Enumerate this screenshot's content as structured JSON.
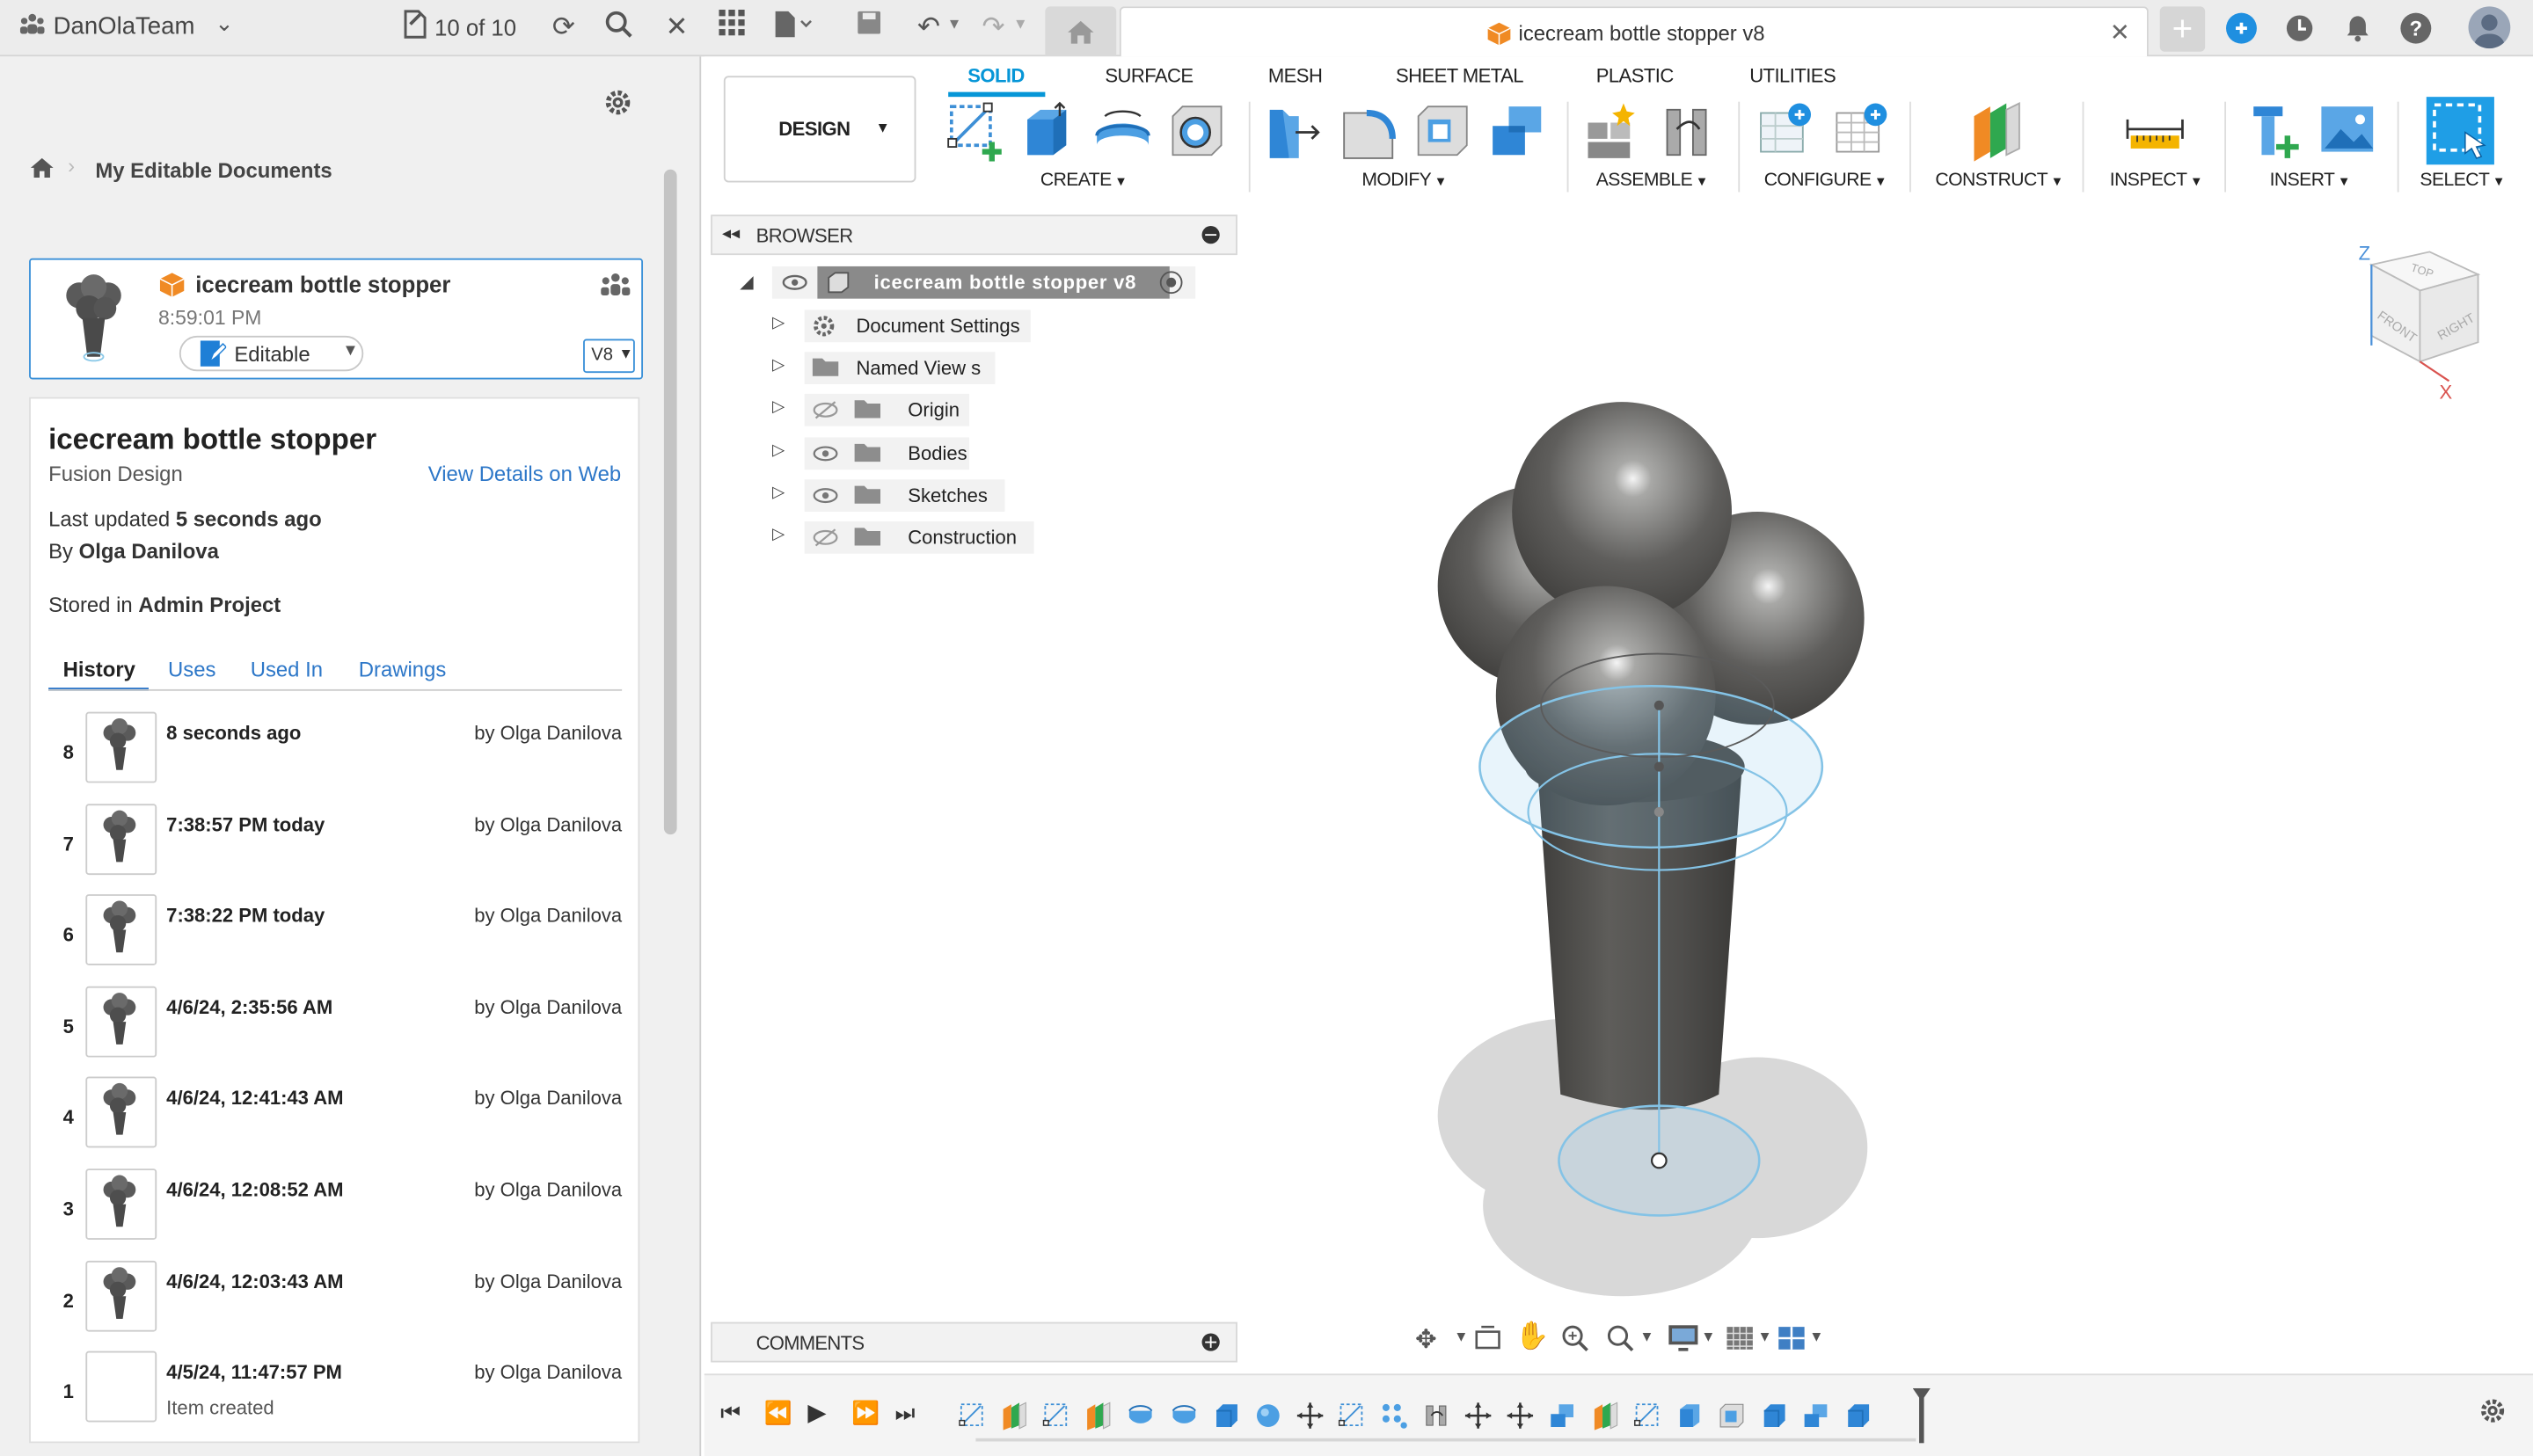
{
  "topbar": {
    "team": "DanOlaTeam",
    "doc_count": "10 of 10",
    "doc_tab_title": "icecream bottle stopper v8"
  },
  "left": {
    "breadcrumb": "My Editable Documents",
    "card": {
      "name": "icecream bottle stopper",
      "time": "8:59:01 PM",
      "status": "Editable",
      "version": "V8"
    },
    "details": {
      "title": "icecream bottle stopper",
      "type": "Fusion Design",
      "web_link": "View Details on Web",
      "updated_label": "Last updated",
      "updated_value": "5 seconds ago",
      "by_label": "By",
      "by_value": "Olga Danilova",
      "stored_label": "Stored in",
      "stored_value": "Admin Project",
      "tabs": [
        "History",
        "Uses",
        "Used In",
        "Drawings"
      ],
      "history": [
        {
          "num": "8",
          "time": "8 seconds ago",
          "by": "by Olga Danilova",
          "note": ""
        },
        {
          "num": "7",
          "time": "7:38:57 PM today",
          "by": "by Olga Danilova",
          "note": ""
        },
        {
          "num": "6",
          "time": "7:38:22 PM today",
          "by": "by Olga Danilova",
          "note": ""
        },
        {
          "num": "5",
          "time": "4/6/24, 2:35:56 AM",
          "by": "by Olga Danilova",
          "note": ""
        },
        {
          "num": "4",
          "time": "4/6/24, 12:41:43 AM",
          "by": "by Olga Danilova",
          "note": ""
        },
        {
          "num": "3",
          "time": "4/6/24, 12:08:52 AM",
          "by": "by Olga Danilova",
          "note": ""
        },
        {
          "num": "2",
          "time": "4/6/24, 12:03:43 AM",
          "by": "by Olga Danilova",
          "note": ""
        },
        {
          "num": "1",
          "time": "4/5/24, 11:47:57 PM",
          "by": "by Olga Danilova",
          "note": "Item created"
        }
      ]
    }
  },
  "toolbar": {
    "workspace": "DESIGN",
    "tabs": [
      "SOLID",
      "SURFACE",
      "MESH",
      "SHEET METAL",
      "PLASTIC",
      "UTILITIES"
    ],
    "groups": [
      "CREATE",
      "MODIFY",
      "ASSEMBLE",
      "CONFIGURE",
      "CONSTRUCT",
      "INSPECT",
      "INSERT",
      "SELECT"
    ]
  },
  "browser": {
    "header": "BROWSER",
    "root": "icecream bottle stopper v8",
    "items": [
      "Document Settings",
      "Named View s",
      "Origin",
      "Bodies",
      "Sketches",
      "Construction"
    ]
  },
  "comments": "COMMENTS",
  "viewcube": {
    "top": "TOP",
    "front": "FRONT",
    "right": "RIGHT",
    "z": "Z",
    "x": "X"
  },
  "colors": {
    "accent": "#0696d7",
    "select_bg": "#1f9ee6",
    "card_border": "#3a90d8"
  }
}
